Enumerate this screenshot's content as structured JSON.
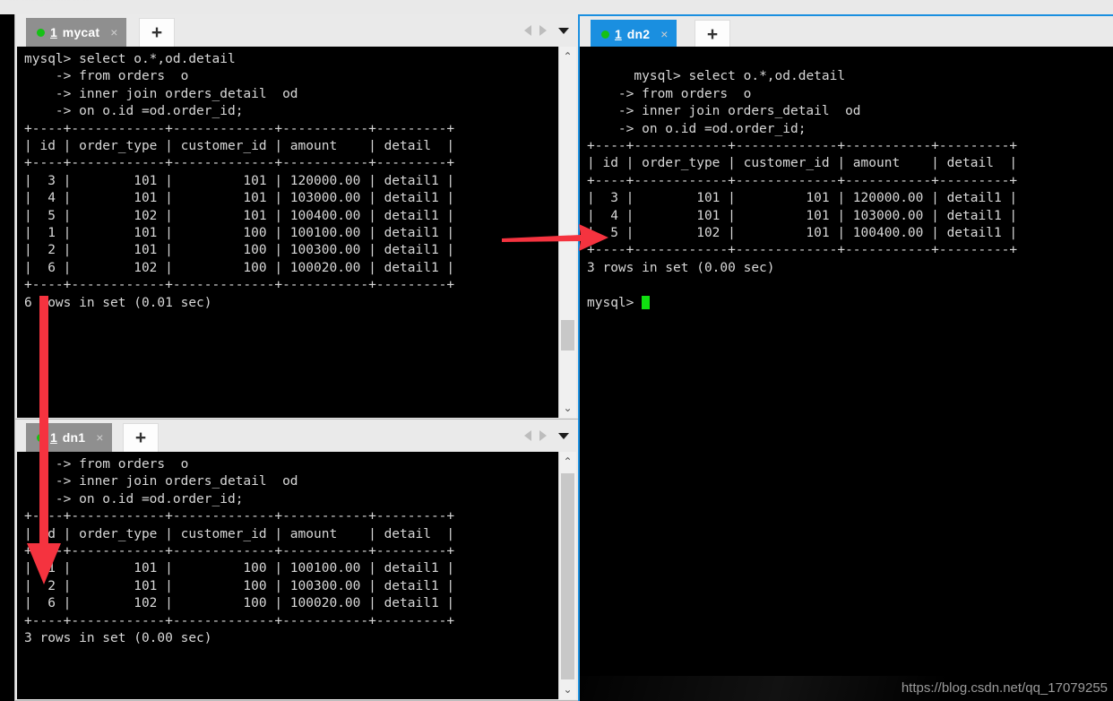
{
  "top_strip": {
    "ghost_text": "···  ·····  ·········  ·· ····"
  },
  "watermark": "https://blog.csdn.net/qq_17079255",
  "colors": {
    "active_tab": "#1a8fe0",
    "inactive_tab": "#8f8f8f",
    "status_dot": "#15c115",
    "arrow": "#f5333f",
    "terminal_bg": "#000000",
    "terminal_fg": "#d8d8d8",
    "cursor": "#10e010"
  },
  "windows": [
    {
      "id": "mycat",
      "tab": {
        "number": "1",
        "label": "mycat",
        "close": "×",
        "state": "inactive"
      },
      "new_tab_label": "+",
      "nav": {
        "prev": "◀",
        "next": "▶",
        "menu": "▾"
      },
      "terminal": {
        "lines": [
          "mysql> select o.*,od.detail",
          "    -> from orders  o",
          "    -> inner join orders_detail  od",
          "    -> on o.id =od.order_id;",
          "+----+------------+-------------+-----------+---------+",
          "| id | order_type | customer_id | amount    | detail  |",
          "+----+------------+-------------+-----------+---------+",
          "|  3 |        101 |         101 | 120000.00 | detail1 |",
          "|  4 |        101 |         101 | 103000.00 | detail1 |",
          "|  5 |        102 |         101 | 100400.00 | detail1 |",
          "|  1 |        101 |         100 | 100100.00 | detail1 |",
          "|  2 |        101 |         100 | 100300.00 | detail1 |",
          "|  6 |        102 |         100 | 100020.00 | detail1 |",
          "+----+------------+-------------+-----------+---------+",
          "6 rows in set (0.01 sec)"
        ],
        "result": {
          "columns": [
            "id",
            "order_type",
            "customer_id",
            "amount",
            "detail"
          ],
          "rows": [
            [
              "3",
              "101",
              "101",
              "120000.00",
              "detail1"
            ],
            [
              "4",
              "101",
              "101",
              "103000.00",
              "detail1"
            ],
            [
              "5",
              "102",
              "101",
              "100400.00",
              "detail1"
            ],
            [
              "1",
              "101",
              "100",
              "100100.00",
              "detail1"
            ],
            [
              "2",
              "101",
              "100",
              "100300.00",
              "detail1"
            ],
            [
              "6",
              "102",
              "100",
              "100020.00",
              "detail1"
            ]
          ],
          "row_count_text": "6 rows in set (0.01 sec)"
        },
        "scrollbar": {
          "up": "⌃",
          "down": "⌄"
        }
      }
    },
    {
      "id": "dn1",
      "tab": {
        "number": "1",
        "label": "dn1",
        "close": "×",
        "state": "inactive"
      },
      "new_tab_label": "+",
      "nav": {
        "prev": "◀",
        "next": "▶",
        "menu": "▾"
      },
      "terminal": {
        "lines": [
          "    -> from orders  o",
          "    -> inner join orders_detail  od",
          "    -> on o.id =od.order_id;",
          "+----+------------+-------------+-----------+---------+",
          "| id | order_type | customer_id | amount    | detail  |",
          "+----+------------+-------------+-----------+---------+",
          "|  1 |        101 |         100 | 100100.00 | detail1 |",
          "|  2 |        101 |         100 | 100300.00 | detail1 |",
          "|  6 |        102 |         100 | 100020.00 | detail1 |",
          "+----+------------+-------------+-----------+---------+",
          "3 rows in set (0.00 sec)"
        ],
        "result": {
          "columns": [
            "id",
            "order_type",
            "customer_id",
            "amount",
            "detail"
          ],
          "rows": [
            [
              "1",
              "101",
              "100",
              "100100.00",
              "detail1"
            ],
            [
              "2",
              "101",
              "100",
              "100300.00",
              "detail1"
            ],
            [
              "6",
              "102",
              "100",
              "100020.00",
              "detail1"
            ]
          ],
          "row_count_text": "3 rows in set (0.00 sec)"
        },
        "scrollbar": {
          "up": "⌃",
          "down": "⌄"
        }
      }
    },
    {
      "id": "dn2",
      "tab": {
        "number": "1",
        "label": "dn2",
        "close": "×",
        "state": "active"
      },
      "new_tab_label": "+",
      "terminal": {
        "lines": [
          "mysql> select o.*,od.detail",
          "    -> from orders  o",
          "    -> inner join orders_detail  od",
          "    -> on o.id =od.order_id;",
          "+----+------------+-------------+-----------+---------+",
          "| id | order_type | customer_id | amount    | detail  |",
          "+----+------------+-------------+-----------+---------+",
          "|  3 |        101 |         101 | 120000.00 | detail1 |",
          "|  4 |        101 |         101 | 103000.00 | detail1 |",
          "|  5 |        102 |         101 | 100400.00 | detail1 |",
          "+----+------------+-------------+-----------+---------+",
          "3 rows in set (0.00 sec)",
          "",
          "mysql> "
        ],
        "result": {
          "columns": [
            "id",
            "order_type",
            "customer_id",
            "amount",
            "detail"
          ],
          "rows": [
            [
              "3",
              "101",
              "101",
              "120000.00",
              "detail1"
            ],
            [
              "4",
              "101",
              "101",
              "103000.00",
              "detail1"
            ],
            [
              "5",
              "102",
              "101",
              "100400.00",
              "detail1"
            ]
          ],
          "row_count_text": "3 rows in set (0.00 sec)"
        },
        "prompt": "mysql> "
      }
    }
  ]
}
